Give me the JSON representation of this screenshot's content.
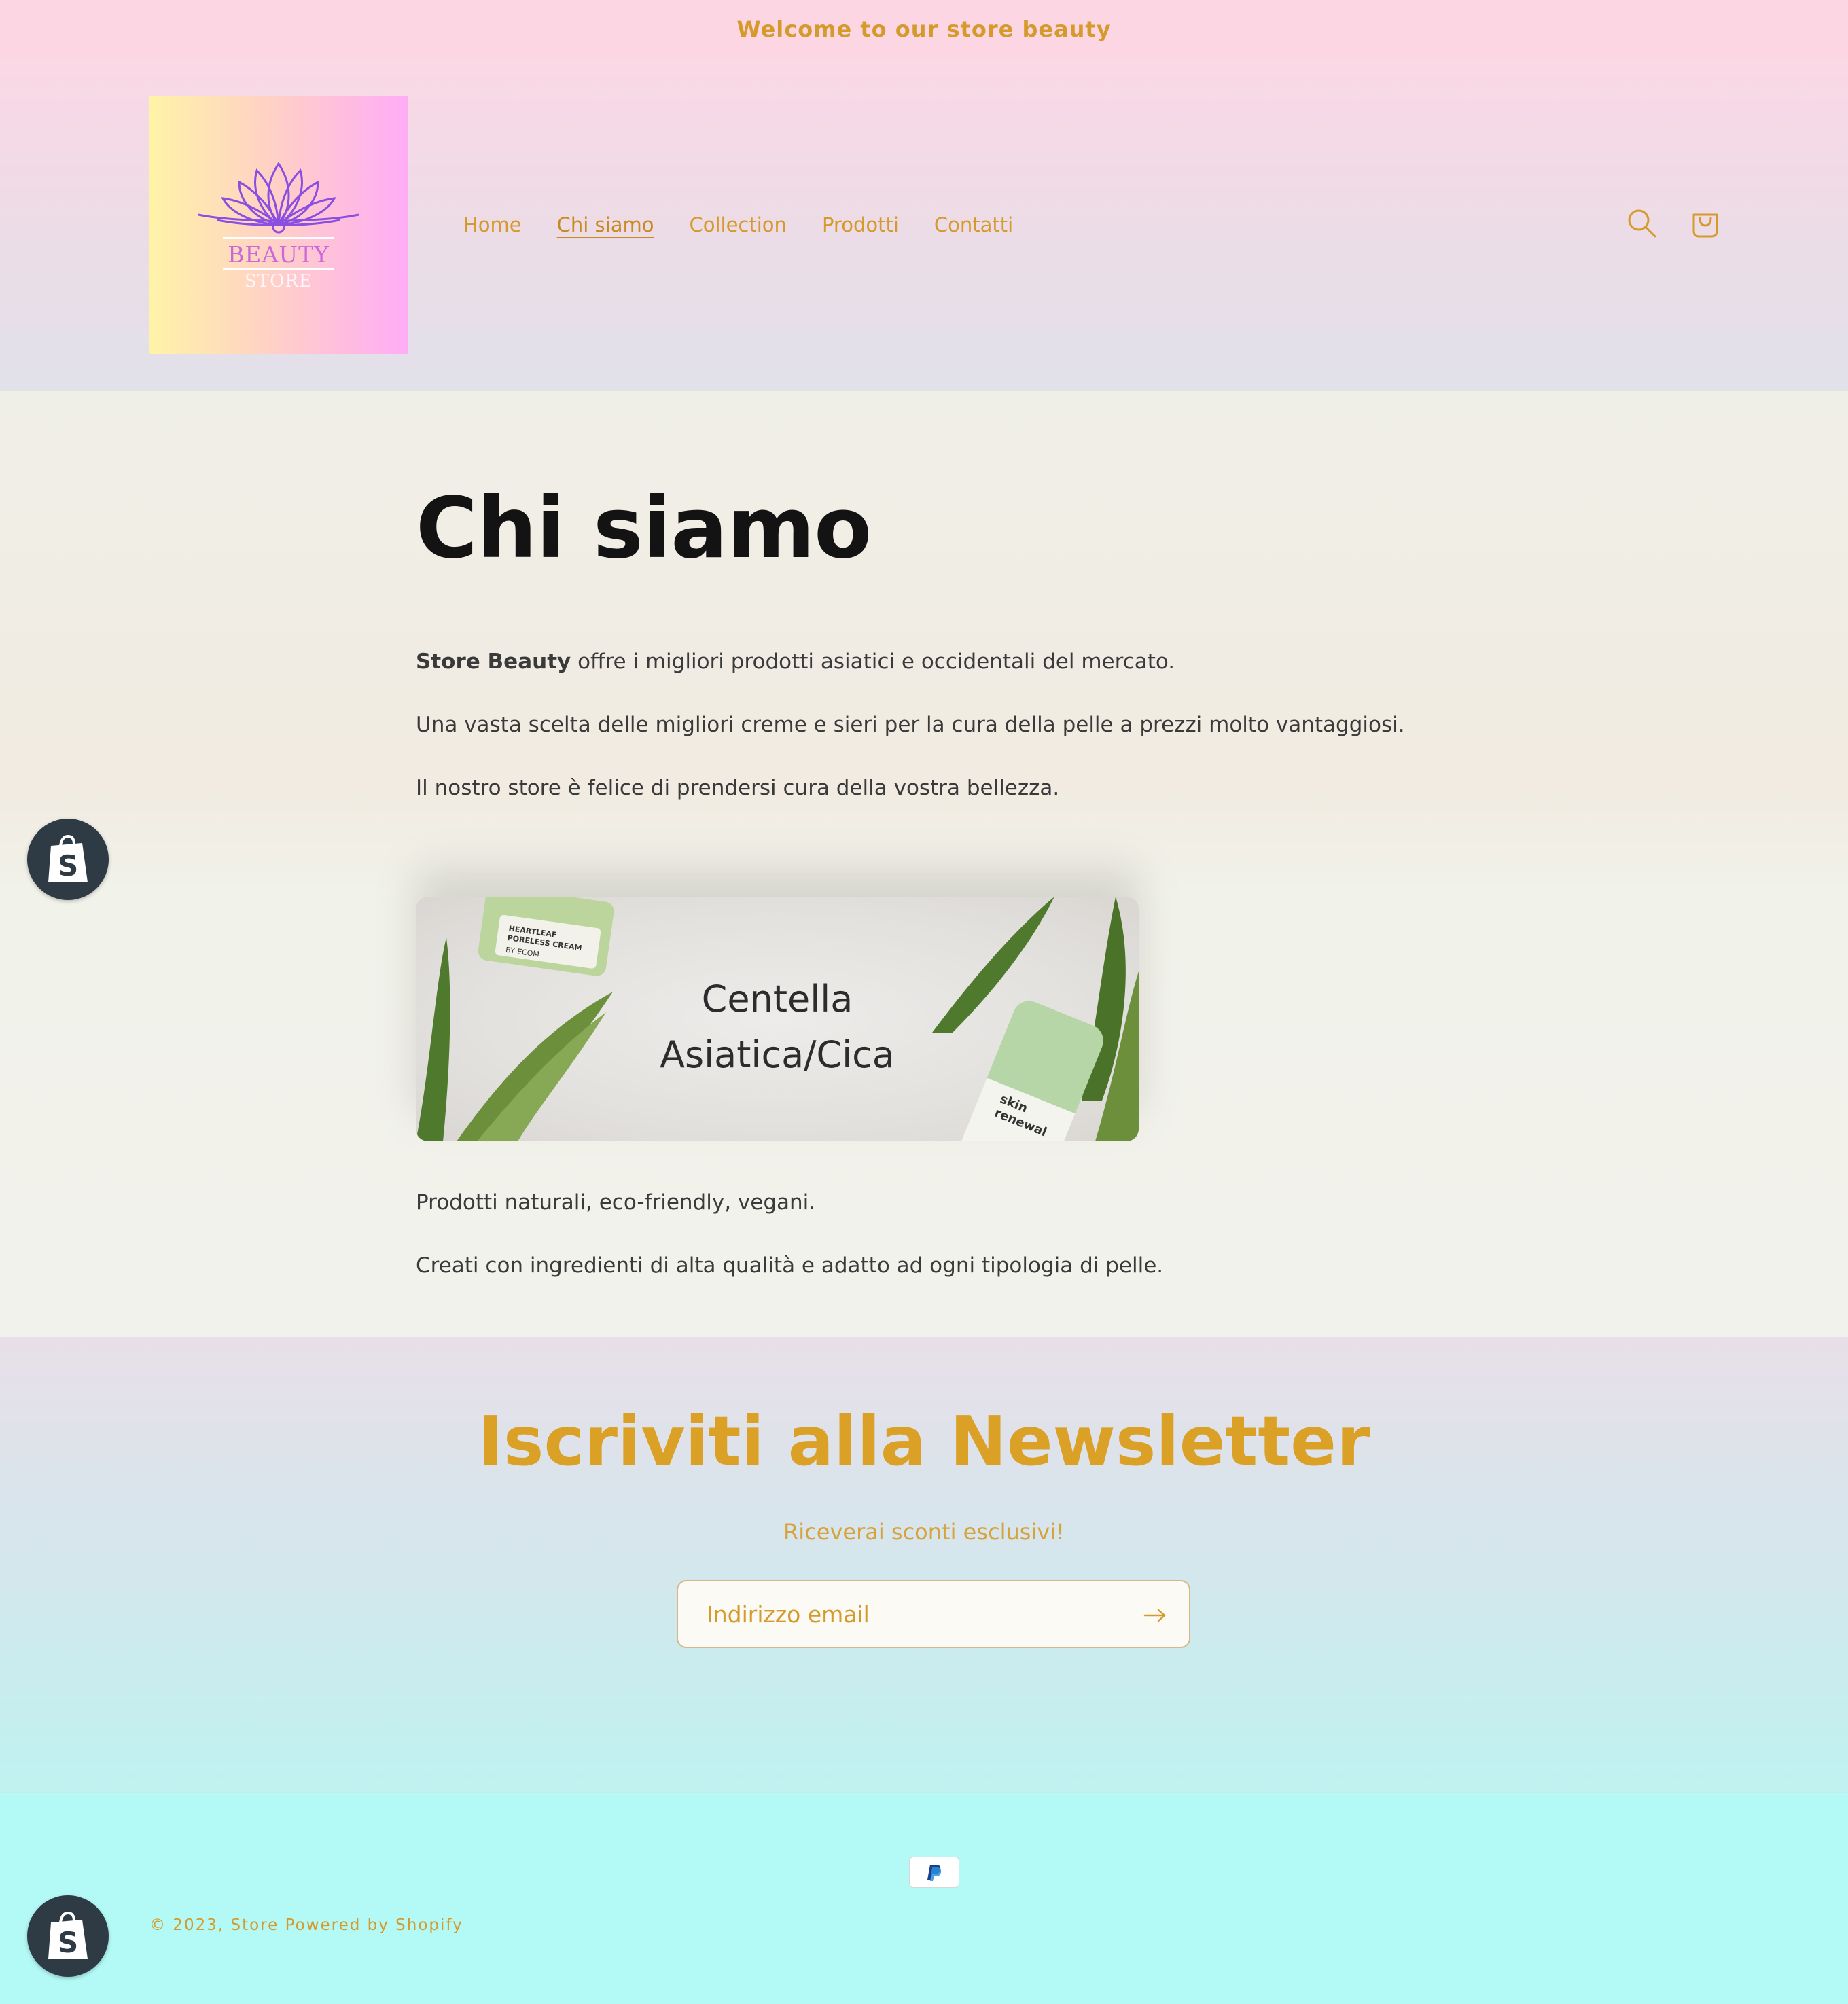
{
  "announcement": {
    "text": "Welcome to our store beauty"
  },
  "header": {
    "logo": {
      "line1": "BEAUTY",
      "line2": "STORE"
    },
    "nav": [
      {
        "label": "Home",
        "active": false
      },
      {
        "label": "Chi siamo",
        "active": true
      },
      {
        "label": "Collection",
        "active": false
      },
      {
        "label": "Prodotti",
        "active": false
      },
      {
        "label": "Contatti",
        "active": false
      }
    ],
    "icons": {
      "search": "search-icon",
      "cart": "cart-icon"
    }
  },
  "page": {
    "title": "Chi siamo",
    "intro_bold": "Store Beauty",
    "intro_rest": " offre i migliori prodotti asiatici e occidentali del mercato.",
    "p2": "Una vasta scelta delle migliori creme e sieri per la cura della pelle a prezzi molto vantaggiosi.",
    "p3": "Il nostro store è felice di prendersi cura della vostra bellezza.",
    "banner": {
      "line1": "Centella",
      "line2": "Asiatica/Cica",
      "jar_label1": "HEARTLEAF",
      "jar_label2": "PORELESS CREAM",
      "jar_brand": "BY ECOM",
      "tube_label1": "skin",
      "tube_label2": "renewal"
    },
    "p4": "Prodotti naturali, eco-friendly, vegani.",
    "p5": "Creati con ingredienti di alta qualità e adatto ad ogni tipologia di pelle."
  },
  "newsletter": {
    "title": "Iscriviti alla Newsletter",
    "subtitle": "Riceverai sconti esclusivi!",
    "email_placeholder": "Indirizzo email"
  },
  "footer": {
    "payment": "PayPal",
    "copyright": "© 2023, Store Powered by Shopify"
  },
  "colors": {
    "accent": "#d59a2c",
    "announcement_bg": "#fdd6e4",
    "footer_bg": "#b3faf6"
  }
}
